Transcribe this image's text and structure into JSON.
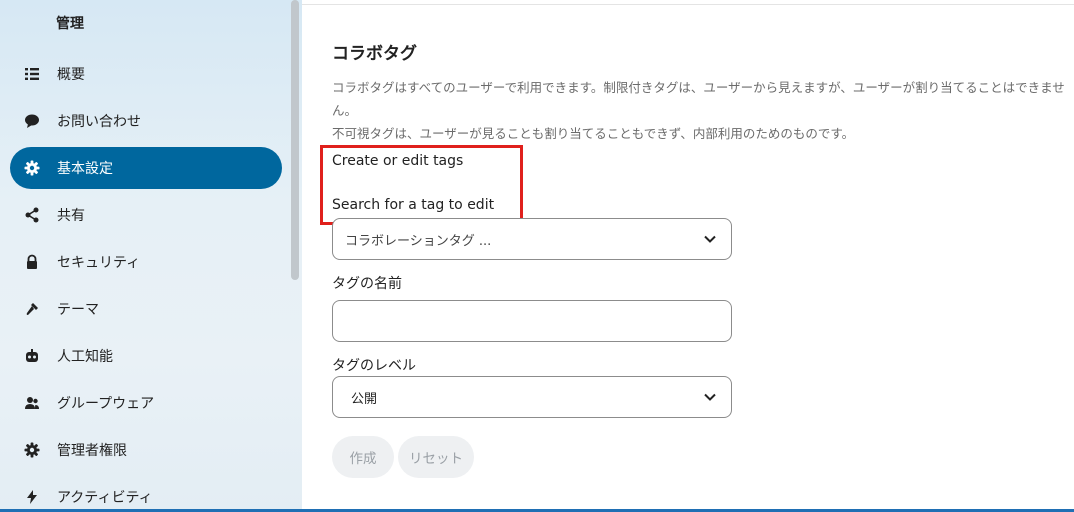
{
  "sidebar": {
    "title": "管理",
    "items": [
      {
        "label": "概要",
        "icon": "list-icon"
      },
      {
        "label": "お問い合わせ",
        "icon": "chat-bubble-icon"
      },
      {
        "label": "基本設定",
        "icon": "gear-icon",
        "active": true
      },
      {
        "label": "共有",
        "icon": "share-icon"
      },
      {
        "label": "セキュリティ",
        "icon": "lock-icon"
      },
      {
        "label": "テーマ",
        "icon": "paintbrush-icon"
      },
      {
        "label": "人工知能",
        "icon": "robot-icon"
      },
      {
        "label": "グループウェア",
        "icon": "group-icon"
      },
      {
        "label": "管理者権限",
        "icon": "admin-gear-icon"
      },
      {
        "label": "アクティビティ",
        "icon": "lightning-icon"
      }
    ]
  },
  "main": {
    "title": "コラボタグ",
    "description_line1": "コラボタグはすべてのユーザーで利用できます。制限付きタグは、ユーザーから見えますが、ユーザーが割り当てることはできません。",
    "description_line2": "不可視タグは、ユーザーが見ることも割り当てることもできず、内部利用のためのものです。",
    "create_edit_label": "Create or edit tags",
    "search_label": "Search for a tag to edit",
    "tag_select_value": "コラボレーションタグ ...",
    "tag_name_label": "タグの名前",
    "tag_name_value": "",
    "tag_level_label": "タグのレベル",
    "tag_level_value": "公開",
    "create_button": "作成",
    "reset_button": "リセット"
  },
  "colors": {
    "accent": "#00679e",
    "highlight": "#e0201c"
  }
}
